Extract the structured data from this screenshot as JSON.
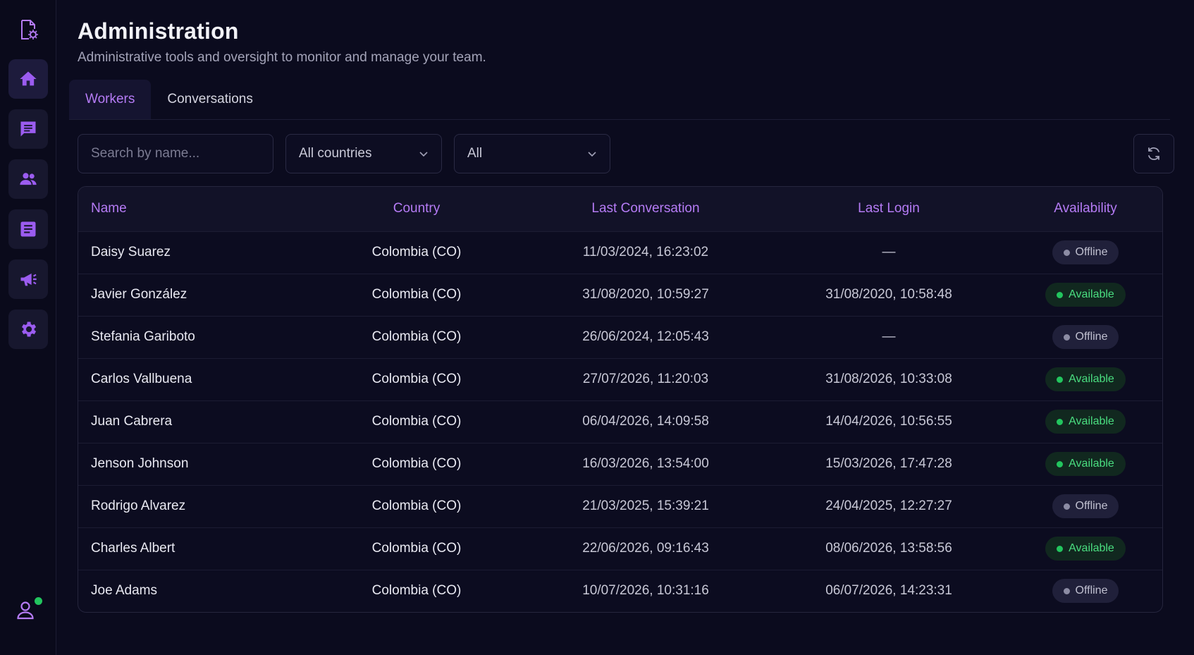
{
  "colors": {
    "accent": "#b57bf5",
    "background": "#0b0b1e",
    "available": "#22c55e",
    "offline": "#8c8ca4"
  },
  "sidebar": {
    "logo_icon": "settings-document-icon",
    "items": [
      {
        "icon": "home-icon",
        "name": "home"
      },
      {
        "icon": "chat-icon",
        "name": "chat"
      },
      {
        "icon": "users-icon",
        "name": "users"
      },
      {
        "icon": "document-icon",
        "name": "documents"
      },
      {
        "icon": "megaphone-icon",
        "name": "campaigns"
      },
      {
        "icon": "gear-icon",
        "name": "settings"
      }
    ],
    "profile_icon": "user-icon"
  },
  "header": {
    "title": "Administration",
    "subtitle": "Administrative tools and oversight to monitor and manage your team."
  },
  "tabs": [
    {
      "label": "Workers",
      "active": true
    },
    {
      "label": "Conversations",
      "active": false
    }
  ],
  "filters": {
    "search_placeholder": "Search by name...",
    "country_selected": "All countries",
    "status_selected": "All"
  },
  "table": {
    "columns": [
      "Name",
      "Country",
      "Last Conversation",
      "Last Login",
      "Availability"
    ],
    "rows": [
      {
        "name": "Daisy Suarez",
        "country": "Colombia (CO)",
        "last_conversation": "11/03/2024, 16:23:02",
        "last_login": "—",
        "availability": "Offline"
      },
      {
        "name": "Javier González",
        "country": "Colombia (CO)",
        "last_conversation": "31/08/2020, 10:59:27",
        "last_login": "31/08/2020, 10:58:48",
        "availability": "Available"
      },
      {
        "name": "Stefania Gariboto",
        "country": "Colombia (CO)",
        "last_conversation": "26/06/2024, 12:05:43",
        "last_login": "—",
        "availability": "Offline"
      },
      {
        "name": "Carlos Vallbuena",
        "country": "Colombia (CO)",
        "last_conversation": "27/07/2026, 11:20:03",
        "last_login": "31/08/2026, 10:33:08",
        "availability": "Available"
      },
      {
        "name": "Juan Cabrera",
        "country": "Colombia (CO)",
        "last_conversation": "06/04/2026, 14:09:58",
        "last_login": "14/04/2026, 10:56:55",
        "availability": "Available"
      },
      {
        "name": "Jenson Johnson",
        "country": "Colombia (CO)",
        "last_conversation": "16/03/2026, 13:54:00",
        "last_login": "15/03/2026, 17:47:28",
        "availability": "Available"
      },
      {
        "name": "Rodrigo Alvarez",
        "country": "Colombia (CO)",
        "last_conversation": "21/03/2025, 15:39:21",
        "last_login": "24/04/2025, 12:27:27",
        "availability": "Offline"
      },
      {
        "name": "Charles Albert",
        "country": "Colombia (CO)",
        "last_conversation": "22/06/2026, 09:16:43",
        "last_login": "08/06/2026, 13:58:56",
        "availability": "Available"
      },
      {
        "name": "Joe Adams",
        "country": "Colombia (CO)",
        "last_conversation": "10/07/2026, 10:31:16",
        "last_login": "06/07/2026, 14:23:31",
        "availability": "Offline"
      }
    ]
  }
}
